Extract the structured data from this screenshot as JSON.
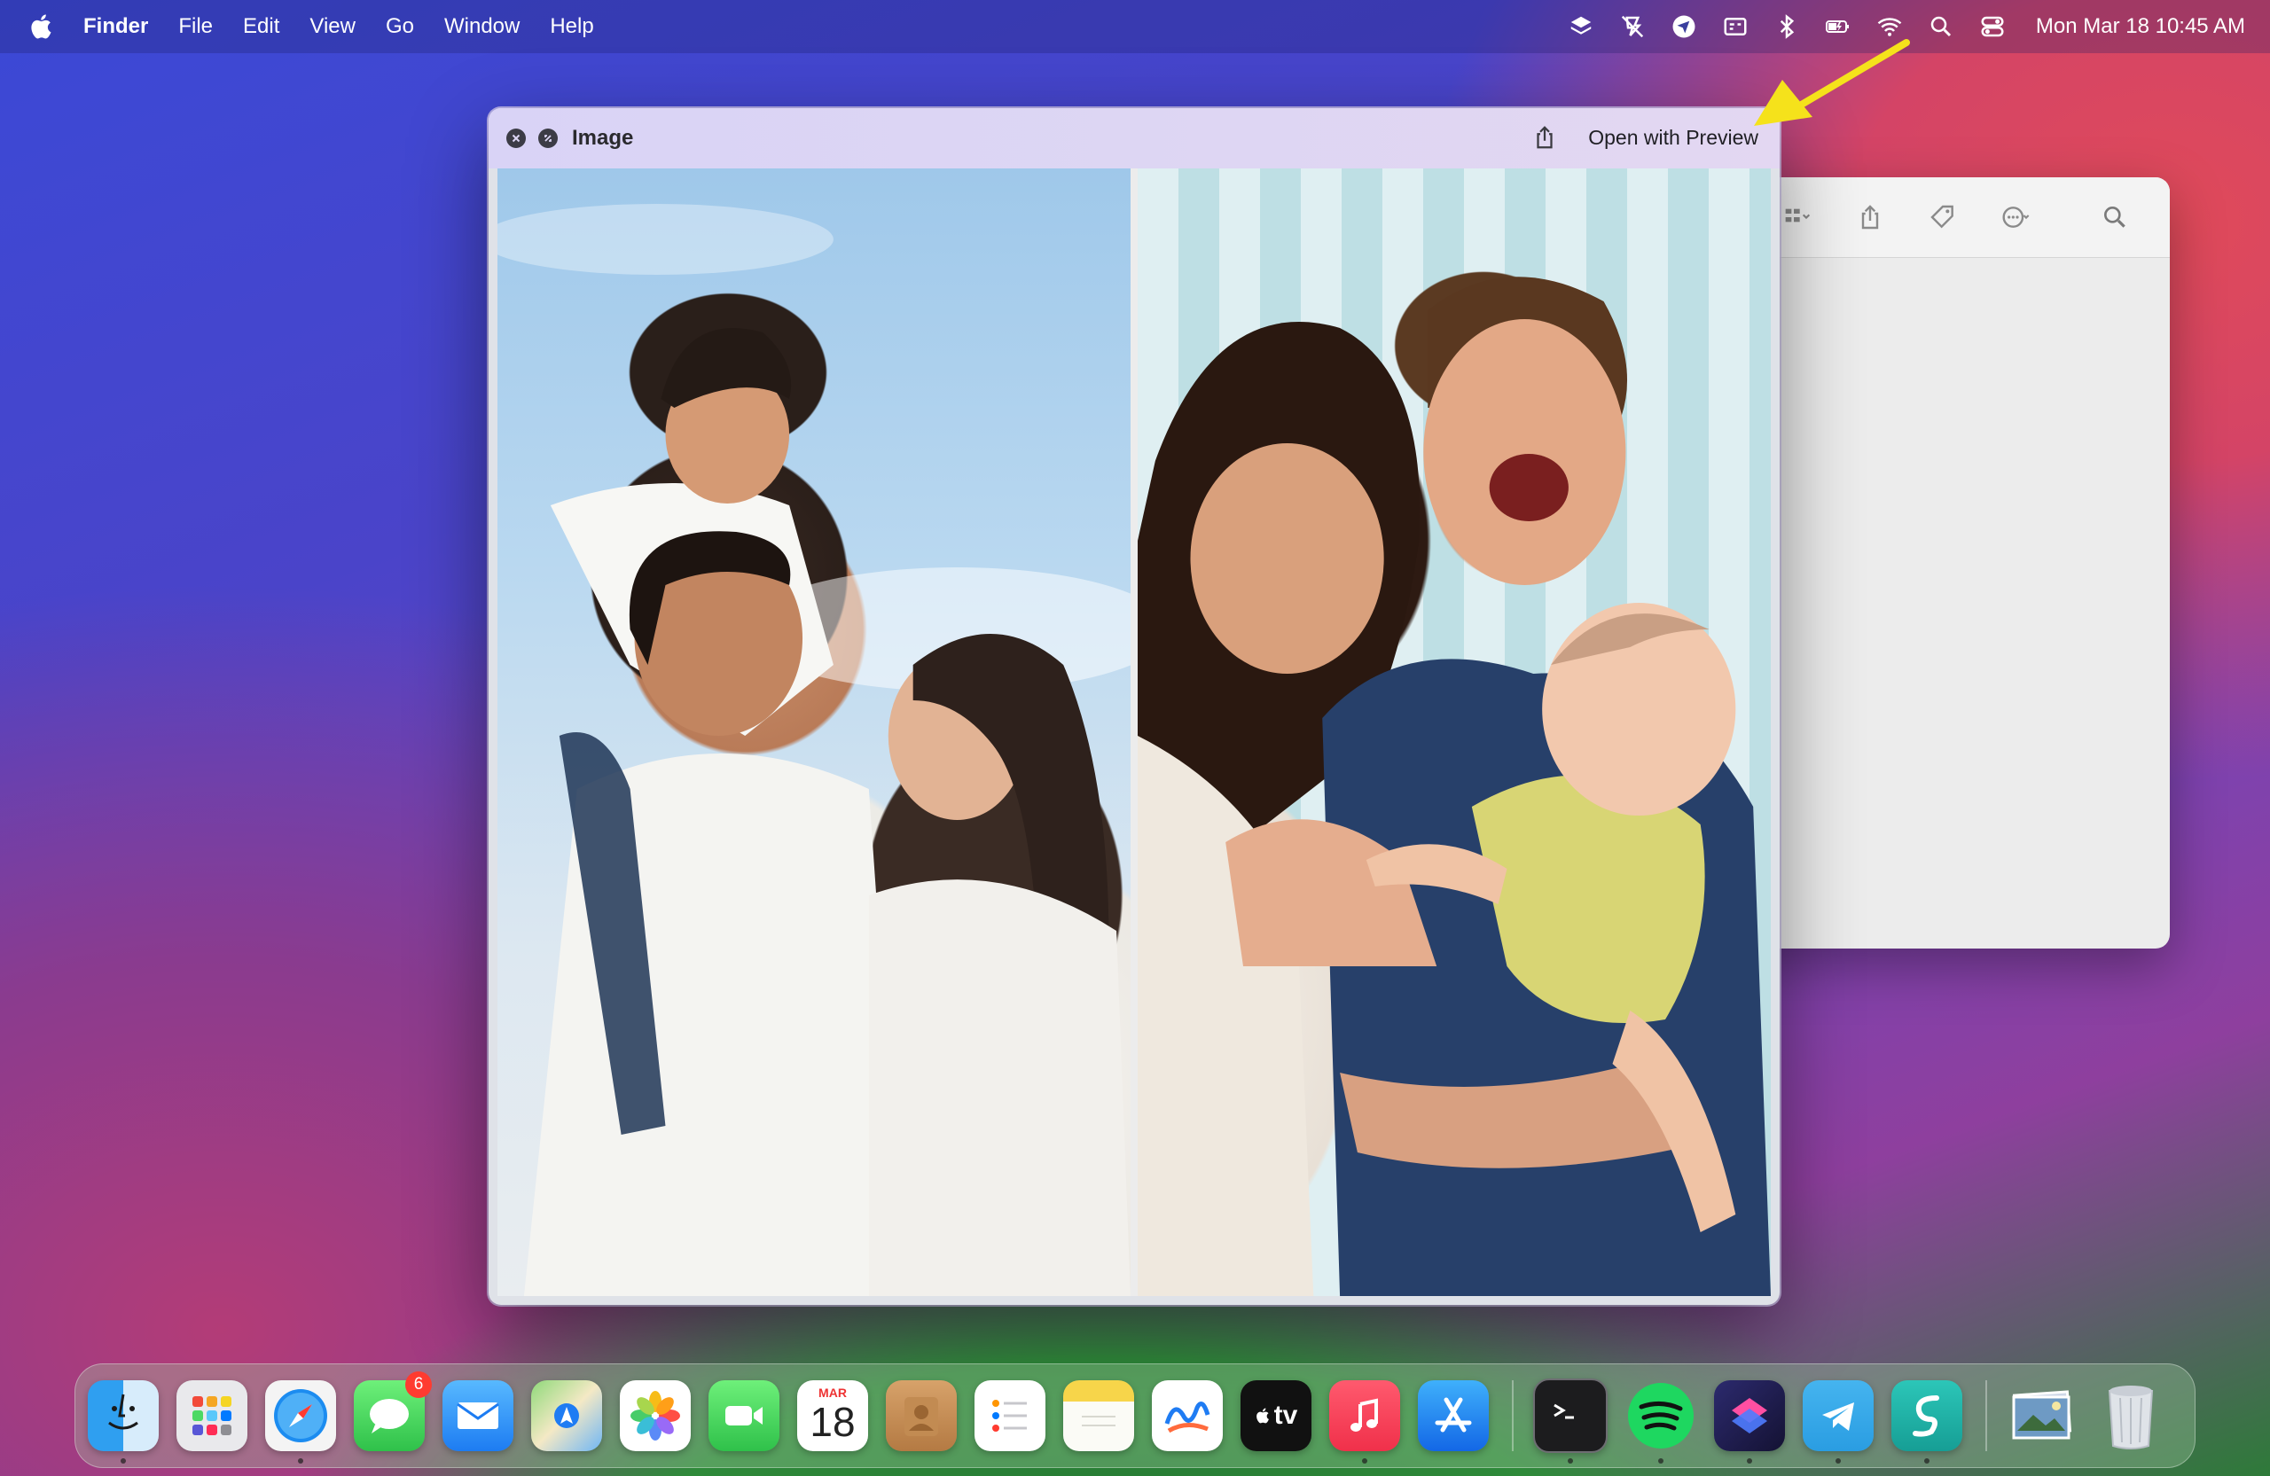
{
  "menubar": {
    "app_name": "Finder",
    "items": [
      "File",
      "Edit",
      "View",
      "Go",
      "Window",
      "Help"
    ],
    "status_icons": [
      "layers-icon",
      "disabled-app-icon",
      "location-icon",
      "card-icon",
      "bluetooth-icon",
      "battery-icon",
      "wifi-icon",
      "search-icon",
      "control-center-icon"
    ],
    "clock": "Mon Mar 18  10:45 AM"
  },
  "quicklook": {
    "title": "Image",
    "open_with_label": "Open with Preview"
  },
  "dock": {
    "items": [
      {
        "name": "Finder",
        "icon": "finder-icon",
        "running": true
      },
      {
        "name": "Launchpad",
        "icon": "launchpad-icon",
        "running": false
      },
      {
        "name": "Safari",
        "icon": "safari-icon",
        "running": true
      },
      {
        "name": "Messages",
        "icon": "messages-icon",
        "running": false,
        "badge": "6"
      },
      {
        "name": "Mail",
        "icon": "mail-icon",
        "running": false
      },
      {
        "name": "Maps",
        "icon": "maps-icon",
        "running": false
      },
      {
        "name": "Photos",
        "icon": "photos-icon",
        "running": false
      },
      {
        "name": "FaceTime",
        "icon": "facetime-icon",
        "running": false
      },
      {
        "name": "Calendar",
        "icon": "calendar-icon",
        "running": false,
        "month": "MAR",
        "day": "18"
      },
      {
        "name": "Contacts",
        "icon": "contacts-icon",
        "running": false
      },
      {
        "name": "Reminders",
        "icon": "reminders-icon",
        "running": false
      },
      {
        "name": "Notes",
        "icon": "notes-icon",
        "running": false
      },
      {
        "name": "Freeform",
        "icon": "freeform-icon",
        "running": false
      },
      {
        "name": "TV",
        "icon": "tv-icon",
        "running": false,
        "label": "tv"
      },
      {
        "name": "Music",
        "icon": "music-icon",
        "running": true
      },
      {
        "name": "App Store",
        "icon": "app-store-icon",
        "running": false
      },
      {
        "name": "Terminal",
        "icon": "terminal-icon",
        "running": true
      },
      {
        "name": "Spotify",
        "icon": "spotify-icon",
        "running": true
      },
      {
        "name": "Shortcuts",
        "icon": "shortcuts-icon",
        "running": true
      },
      {
        "name": "Telegram",
        "icon": "telegram-icon",
        "running": true
      },
      {
        "name": "Surfshark",
        "icon": "surfshark-icon",
        "running": true
      },
      {
        "name": "Image Capture",
        "icon": "image-stack-icon",
        "running": false
      },
      {
        "name": "Trash",
        "icon": "trash-icon",
        "running": false
      }
    ]
  },
  "colors": {
    "arrow": "#f5e21b",
    "badge": "#ff3b30"
  }
}
